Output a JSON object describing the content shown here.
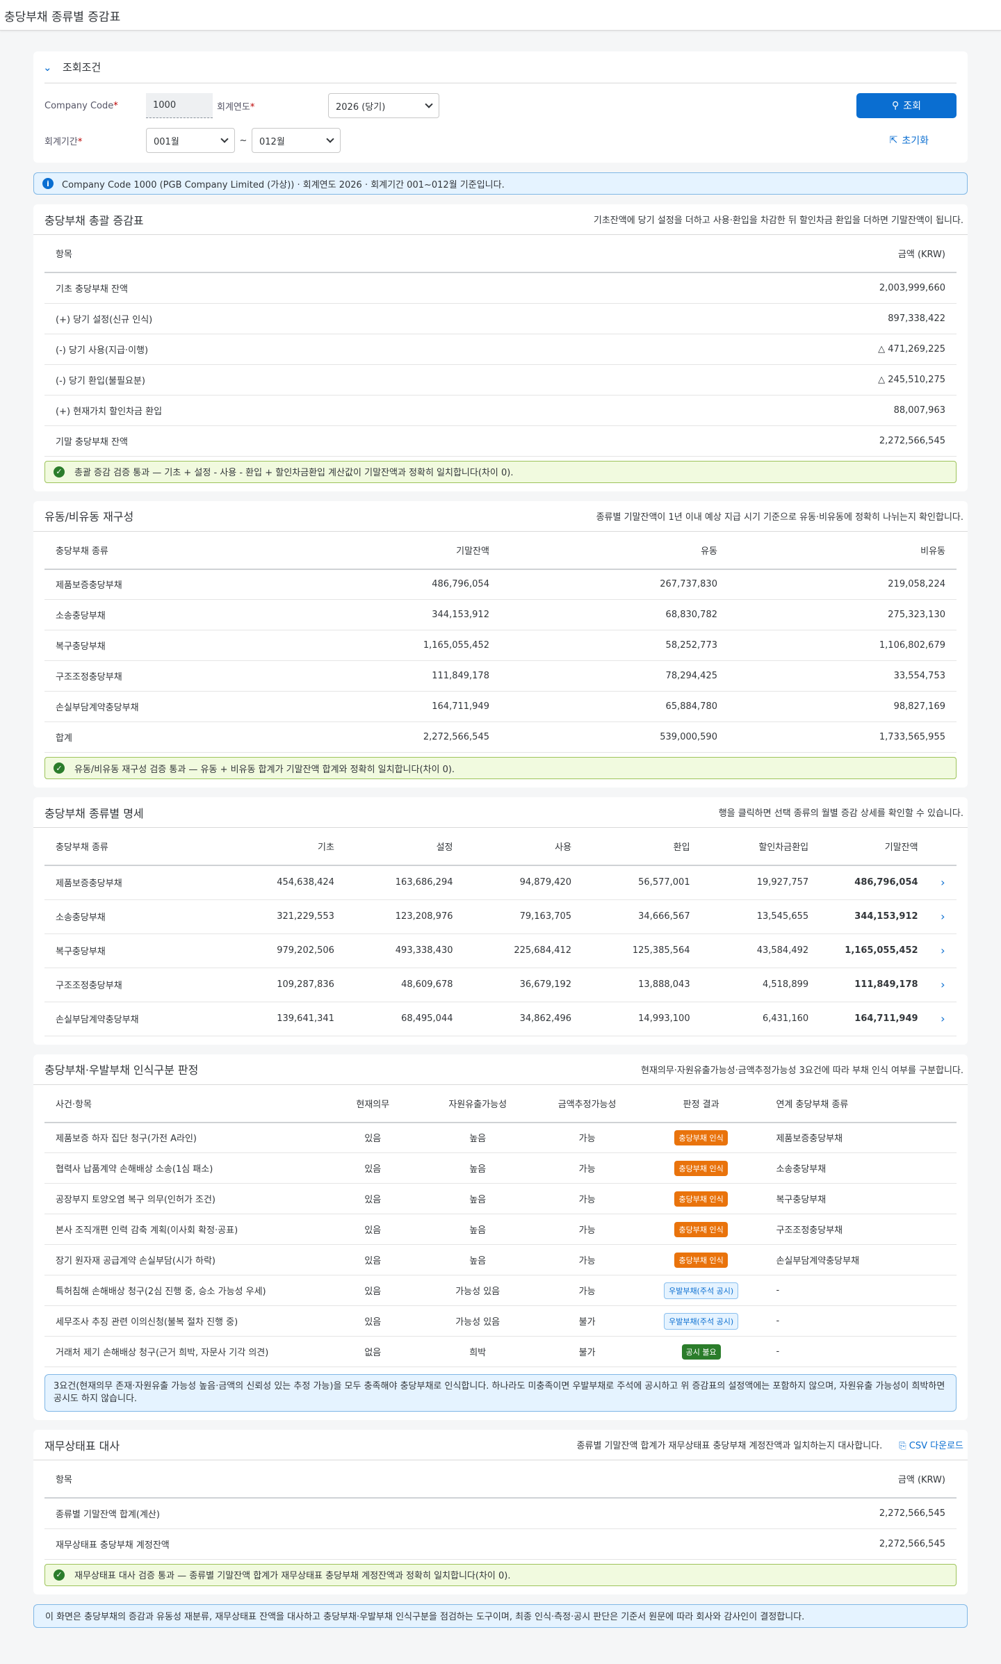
{
  "page": {
    "title": "충당부채 종류별 증감표"
  },
  "filter": {
    "header": "조회조건",
    "company_label": "Company Code",
    "company_value": "1000",
    "year_label": "회계연도",
    "year_value": "2026 (당기)",
    "period_label": "회계기간",
    "period_from": "001월",
    "period_sep": "~",
    "period_to": "012월",
    "search_label": "조회",
    "reset_label": "초기화"
  },
  "info_text": "Company Code 1000 (PGB Company Limited (가상)) · 회계연도 2026 · 회계기간 001~012월 기준입니다.",
  "summary": {
    "title": "충당부채 총괄 증감표",
    "desc": "기초잔액에 당기 설정을 더하고 사용·환입을 차감한 뒤 할인차금 환입을 더하면 기말잔액이 됩니다.",
    "col_item": "항목",
    "col_amount": "금액 (KRW)",
    "rows": [
      {
        "item": "기초 충당부채 잔액",
        "amount": "2,003,999,660"
      },
      {
        "item": "(+) 당기 설정(신규 인식)",
        "amount": "897,338,422"
      },
      {
        "item": "(-) 당기 사용(지급·이행)",
        "amount": "△ 471,269,225"
      },
      {
        "item": "(-) 당기 환입(불필요분)",
        "amount": "△ 245,510,275"
      },
      {
        "item": "(+) 현재가치 할인차금 환입",
        "amount": "88,007,963"
      },
      {
        "item": "기말 충당부채 잔액",
        "amount": "2,272,566,545"
      }
    ],
    "check": "총괄 증감 검증 통과 — 기초 + 설정 - 사용 - 환입 + 할인차금환입 계산값이 기말잔액과 정확히 일치합니다(차이 0)."
  },
  "current": {
    "title": "유동/비유동 재구성",
    "desc": "종류별 기말잔액이 1년 이내 예상 지급 시기 기준으로 유동·비유동에 정확히 나뉘는지 확인합니다.",
    "cols": [
      "충당부채 종류",
      "기말잔액",
      "유동",
      "비유동"
    ],
    "rows": [
      [
        "제품보증충당부채",
        "486,796,054",
        "267,737,830",
        "219,058,224"
      ],
      [
        "소송충당부채",
        "344,153,912",
        "68,830,782",
        "275,323,130"
      ],
      [
        "복구충당부채",
        "1,165,055,452",
        "58,252,773",
        "1,106,802,679"
      ],
      [
        "구조조정충당부채",
        "111,849,178",
        "78,294,425",
        "33,554,753"
      ],
      [
        "손실부담계약충당부채",
        "164,711,949",
        "65,884,780",
        "98,827,169"
      ],
      [
        "합계",
        "2,272,566,545",
        "539,000,590",
        "1,733,565,955"
      ]
    ],
    "check": "유동/비유동 재구성 검증 통과 — 유동 + 비유동 합계가 기말잔액 합계와 정확히 일치합니다(차이 0)."
  },
  "detail": {
    "title": "충당부채 종류별 명세",
    "desc": "행을 클릭하면 선택 종류의 월별 증감 상세를 확인할 수 있습니다.",
    "cols": [
      "충당부채 종류",
      "기초",
      "설정",
      "사용",
      "환입",
      "할인차금환입",
      "기말잔액"
    ],
    "rows": [
      [
        "제품보증충당부채",
        "454,638,424",
        "163,686,294",
        "94,879,420",
        "56,577,001",
        "19,927,757",
        "486,796,054"
      ],
      [
        "소송충당부채",
        "321,229,553",
        "123,208,976",
        "79,163,705",
        "34,666,567",
        "13,545,655",
        "344,153,912"
      ],
      [
        "복구충당부채",
        "979,202,506",
        "493,338,430",
        "225,684,412",
        "125,385,564",
        "43,584,492",
        "1,165,055,452"
      ],
      [
        "구조조정충당부채",
        "109,287,836",
        "48,609,678",
        "36,679,192",
        "13,888,043",
        "4,518,899",
        "111,849,178"
      ],
      [
        "손실부담계약충당부채",
        "139,641,341",
        "68,495,044",
        "34,862,496",
        "14,993,100",
        "6,431,160",
        "164,711,949"
      ]
    ]
  },
  "recognition": {
    "title": "충당부채·우발부채 인식구분 판정",
    "desc": "현재의무·자원유출가능성·금액추정가능성 3요건에 따라 부채 인식 여부를 구분합니다.",
    "cols": [
      "사건·항목",
      "현재의무",
      "자원유출가능성",
      "금액추정가능성",
      "판정 결과",
      "연계 충당부채 종류"
    ],
    "rows": [
      {
        "event": "제품보증 하자 집단 청구(가전 A라인)",
        "ob": "있음",
        "out": "높음",
        "est": "가능",
        "result": "충당부채 인식",
        "tone": "orange",
        "link": "제품보증충당부채"
      },
      {
        "event": "협력사 납품계약 손해배상 소송(1심 패소)",
        "ob": "있음",
        "out": "높음",
        "est": "가능",
        "result": "충당부채 인식",
        "tone": "orange",
        "link": "소송충당부채"
      },
      {
        "event": "공장부지 토양오염 복구 의무(인허가 조건)",
        "ob": "있음",
        "out": "높음",
        "est": "가능",
        "result": "충당부채 인식",
        "tone": "orange",
        "link": "복구충당부채"
      },
      {
        "event": "본사 조직개편 인력 감축 계획(이사회 확정·공표)",
        "ob": "있음",
        "out": "높음",
        "est": "가능",
        "result": "충당부채 인식",
        "tone": "orange",
        "link": "구조조정충당부채"
      },
      {
        "event": "장기 원자재 공급계약 손실부담(시가 하락)",
        "ob": "있음",
        "out": "높음",
        "est": "가능",
        "result": "충당부채 인식",
        "tone": "orange",
        "link": "손실부담계약충당부채"
      },
      {
        "event": "특허침해 손해배상 청구(2심 진행 중, 승소 가능성 우세)",
        "ob": "있음",
        "out": "가능성 있음",
        "est": "가능",
        "result": "우발부채(주석 공시)",
        "tone": "blue",
        "link": "-"
      },
      {
        "event": "세무조사 추징 관련 이의신청(불복 절차 진행 중)",
        "ob": "있음",
        "out": "가능성 있음",
        "est": "불가",
        "result": "우발부채(주석 공시)",
        "tone": "blue",
        "link": "-"
      },
      {
        "event": "거래처 제기 손해배상 청구(근거 희박, 자문사 기각 의견)",
        "ob": "없음",
        "out": "희박",
        "est": "불가",
        "result": "공시 불요",
        "tone": "green",
        "link": "-"
      }
    ],
    "note": "3요건(현재의무 존재·자원유출 가능성 높음·금액의 신뢰성 있는 추정 가능)을 모두 충족해야 충당부채로 인식합니다. 하나라도 미충족이면 우발부채로 주석에 공시하고 위 증감표의 설정액에는 포함하지 않으며, 자원유출 가능성이 희박하면 공시도 하지 않습니다."
  },
  "balance": {
    "title": "재무상태표 대사",
    "desc": "종류별 기말잔액 합계가 재무상태표 충당부채 계정잔액과 일치하는지 대사합니다.",
    "csv_label": "CSV 다운로드",
    "col_item": "항목",
    "col_amount": "금액 (KRW)",
    "rows": [
      {
        "item": "종류별 기말잔액 합계(계산)",
        "amount": "2,272,566,545"
      },
      {
        "item": "재무상태표 충당부채 계정잔액",
        "amount": "2,272,566,545"
      }
    ],
    "check": "재무상태표 대사 검증 통과 — 종류별 기말잔액 합계가 재무상태표 충당부채 계정잔액과 정확히 일치합니다(차이 0)."
  },
  "footer_note": "이 화면은 충당부채의 증감과 유동성 재분류, 재무상태표 잔액을 대사하고 충당부채·우발부채 인식구분을 점검하는 도구이며, 최종 인식·측정·공시 판단은 기준서 원문에 따라 회사와 감사인이 결정합니다."
}
